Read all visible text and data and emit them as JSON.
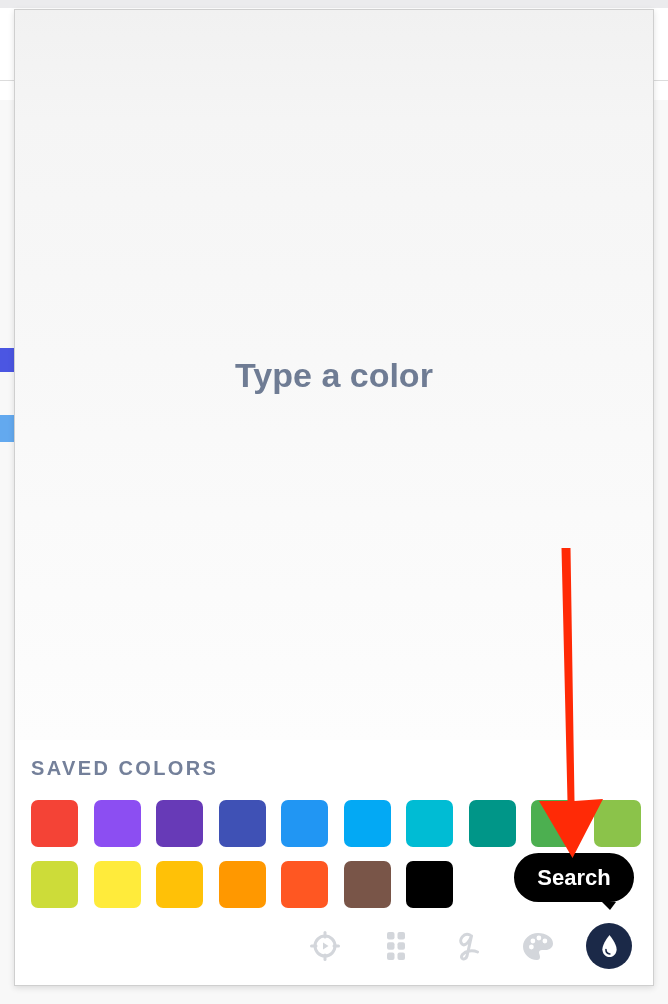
{
  "popup": {
    "prompt": "Type a color",
    "saved_colors": {
      "title": "SAVED COLORS",
      "swatches": [
        {
          "color": "#f44336"
        },
        {
          "color": "#8c4ef2"
        },
        {
          "color": "#673ab7"
        },
        {
          "color": "#3f51b5"
        },
        {
          "color": "#2196f3"
        },
        {
          "color": "#03a9f4"
        },
        {
          "color": "#00bcd4"
        },
        {
          "color": "#009688"
        },
        {
          "color": "#4caf50"
        },
        {
          "color": "#8bc34a"
        },
        {
          "color": "#cddc39"
        },
        {
          "color": "#ffeb3b"
        },
        {
          "color": "#ffc107"
        },
        {
          "color": "#ff9800"
        },
        {
          "color": "#ff5722"
        },
        {
          "color": "#795548"
        },
        {
          "color": "#000000"
        }
      ]
    },
    "toolbar": {
      "tools": [
        {
          "kind": "crosshair",
          "selected": false
        },
        {
          "kind": "grid",
          "selected": false
        },
        {
          "kind": "script",
          "selected": false
        },
        {
          "kind": "palette",
          "selected": false
        },
        {
          "kind": "drop",
          "selected": true
        }
      ],
      "tooltip": "Search"
    }
  }
}
